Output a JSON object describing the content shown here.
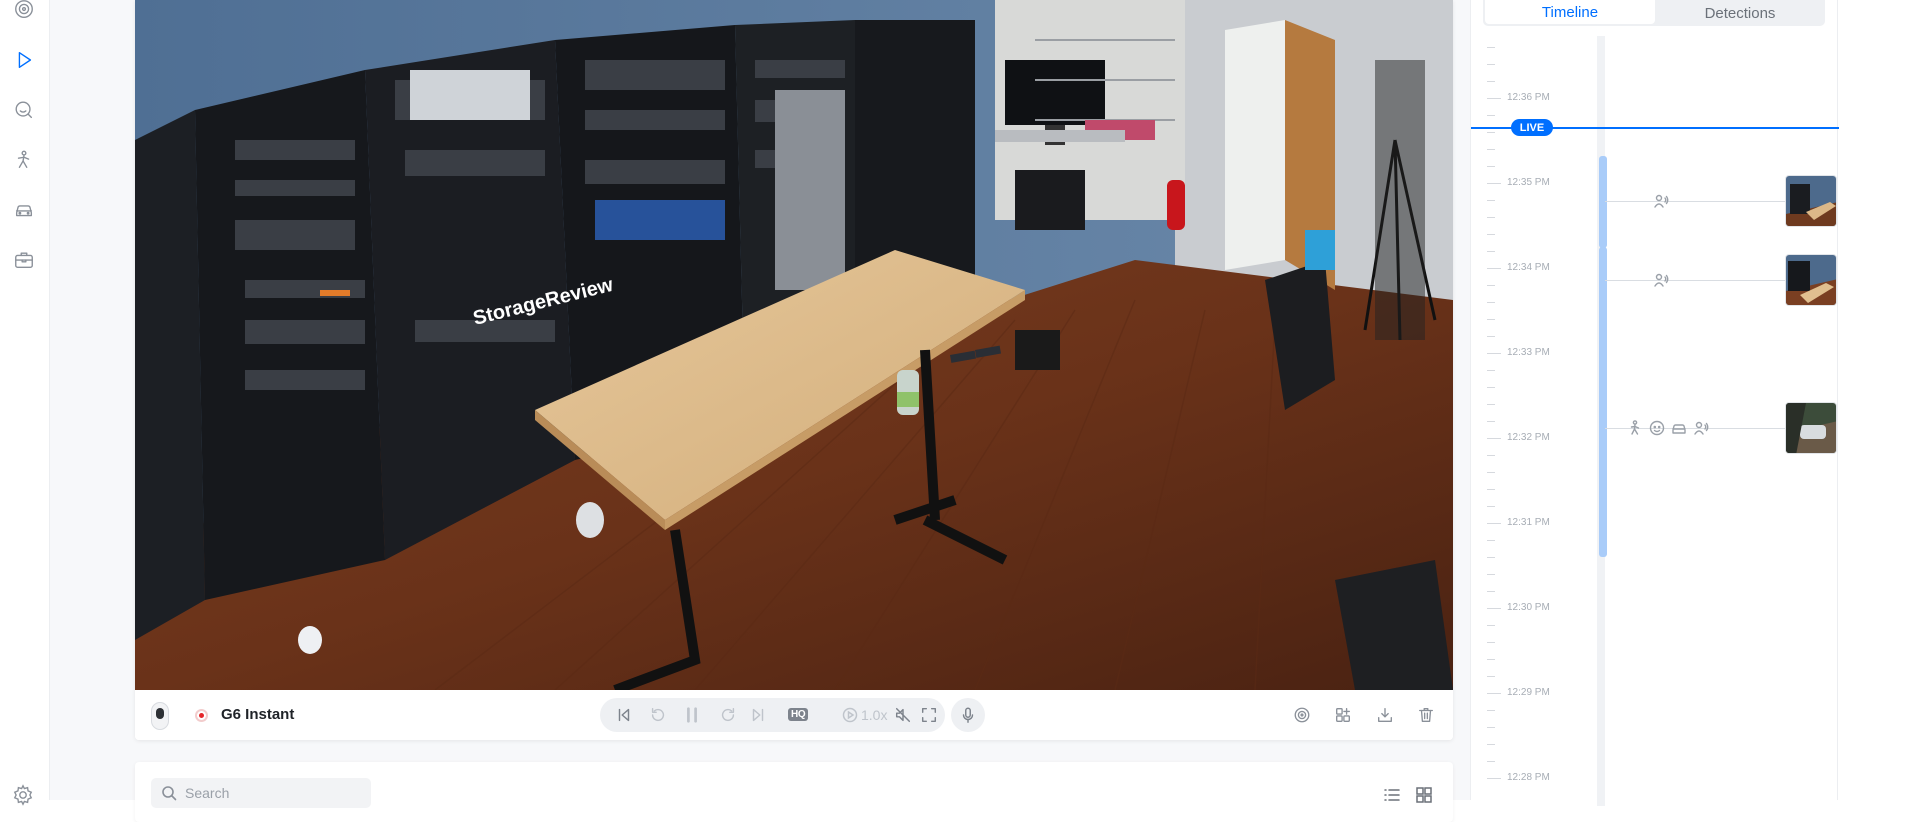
{
  "nav": {
    "items": [
      {
        "name": "detection-icon",
        "active": false
      },
      {
        "name": "play-icon",
        "active": true
      },
      {
        "name": "search-face-icon",
        "active": false
      },
      {
        "name": "person-icon",
        "active": false
      },
      {
        "name": "vehicle-icon",
        "active": false
      },
      {
        "name": "package-icon",
        "active": false
      }
    ],
    "settings_icon": "settings-icon"
  },
  "camera": {
    "name": "G6 Instant",
    "recording_color": "#e5262a"
  },
  "player": {
    "hq_label": "HQ",
    "speed_label": "1.0x"
  },
  "lower": {
    "search_placeholder": "Search"
  },
  "panel": {
    "tabs": [
      {
        "label": "Timeline",
        "active": true
      },
      {
        "label": "Detections",
        "active": false
      }
    ],
    "live_label": "LIVE",
    "time_labels": [
      "12:36 PM",
      "12:35 PM",
      "12:34 PM",
      "12:33 PM",
      "12:32 PM",
      "12:31 PM",
      "12:30 PM",
      "12:29 PM",
      "12:28 PM"
    ],
    "events": [
      {
        "icons": [
          "person-audio-icon"
        ]
      },
      {
        "icons": [
          "person-audio-icon"
        ]
      },
      {
        "icons": [
          "person-icon",
          "face-icon",
          "vehicle-icon",
          "person-audio-icon"
        ]
      }
    ]
  },
  "colors": {
    "accent": "#006fff",
    "timeline_segment": "#a9ccf9"
  }
}
